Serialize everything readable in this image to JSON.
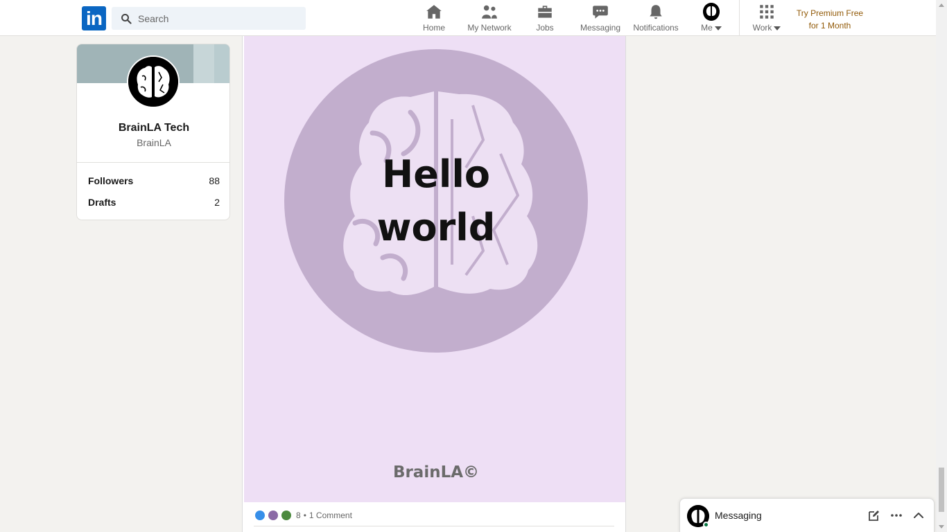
{
  "nav": {
    "logo_text": "in",
    "search_placeholder": "Search",
    "items": [
      {
        "label": "Home",
        "icon": "home-icon"
      },
      {
        "label": "My Network",
        "icon": "network-icon"
      },
      {
        "label": "Jobs",
        "icon": "briefcase-icon"
      },
      {
        "label": "Messaging",
        "icon": "chat-icon"
      },
      {
        "label": "Notifications",
        "icon": "bell-icon"
      },
      {
        "label": "Me",
        "icon": "avatar"
      },
      {
        "label": "Work",
        "icon": "grid-icon"
      }
    ],
    "premium_line1": "Try Premium Free",
    "premium_line2": "for 1 Month"
  },
  "profile": {
    "name": "BrainLA Tech",
    "subtitle": "BrainLA",
    "stats": [
      {
        "label": "Followers",
        "value": "88"
      },
      {
        "label": "Drafts",
        "value": "2"
      }
    ]
  },
  "post": {
    "image_text_line1": "Hello",
    "image_text_line2": "world",
    "image_footer": "BrainLA©",
    "reaction_count": "8",
    "separator": "•",
    "comments": "1 Comment"
  },
  "messaging": {
    "title": "Messaging"
  },
  "colors": {
    "brand": "#0a66c2",
    "premium": "#915907",
    "image_bg": "#eedff5",
    "circle": "#c2aecd"
  }
}
